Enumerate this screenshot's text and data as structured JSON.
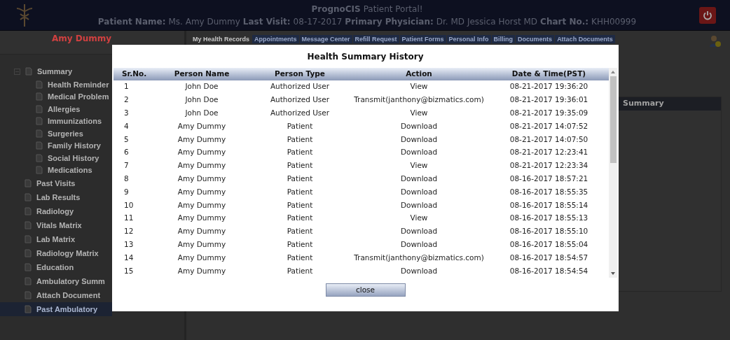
{
  "header": {
    "brand": "PrognoCIS",
    "title": "Patient Portal!",
    "fields": [
      {
        "label": "Patient Name:",
        "value": "Ms. Amy Dummy"
      },
      {
        "label": "Last Visit:",
        "value": "08-17-2017"
      },
      {
        "label": "Primary Physician:",
        "value": "Dr. MD Jessica Horst MD"
      },
      {
        "label": "Chart No.:",
        "value": "KHH00999"
      }
    ]
  },
  "sidebar": {
    "patient_name": "Amy Dummy",
    "tree": [
      {
        "label": "Summary",
        "expanded": true,
        "selected": false,
        "children": [
          {
            "label": "Health Reminder",
            "selected": false
          },
          {
            "label": "Medical Problem",
            "selected": false
          },
          {
            "label": "Allergies",
            "selected": false
          },
          {
            "label": "Immunizations",
            "selected": false
          },
          {
            "label": "Surgeries",
            "selected": false
          },
          {
            "label": "Family History",
            "selected": false
          },
          {
            "label": "Social History",
            "selected": false
          },
          {
            "label": "Medications",
            "selected": false
          }
        ]
      },
      {
        "label": "Past Visits",
        "selected": false
      },
      {
        "label": "Lab Results",
        "selected": false
      },
      {
        "label": "Radiology",
        "selected": false
      },
      {
        "label": "Vitals Matrix",
        "selected": false
      },
      {
        "label": "Lab Matrix",
        "selected": false
      },
      {
        "label": "Radiology Matrix",
        "selected": false
      },
      {
        "label": "Education",
        "selected": false
      },
      {
        "label": "Ambulatory Summ",
        "selected": false
      },
      {
        "label": "Attach Document",
        "selected": false
      },
      {
        "label": "Past Ambulatory",
        "selected": true
      }
    ]
  },
  "tabs": [
    {
      "label": "My Health Records",
      "selected": true
    },
    {
      "label": "Appointments",
      "selected": false
    },
    {
      "label": "Message Center",
      "selected": false
    },
    {
      "label": "Refill Request",
      "selected": false
    },
    {
      "label": "Patient Forms",
      "selected": false
    },
    {
      "label": "Personal Info",
      "selected": false
    },
    {
      "label": "Billing",
      "selected": false
    },
    {
      "label": "Documents",
      "selected": false
    },
    {
      "label": "Attach Documents",
      "selected": false
    }
  ],
  "panel": {
    "heading": "Summary"
  },
  "dialog": {
    "title": "Health Summary History",
    "columns": [
      "Sr.No.",
      "Person Name",
      "Person Type",
      "Action",
      "Date & Time(PST)"
    ],
    "rows": [
      [
        "1",
        "John Doe",
        "Authorized User",
        "View",
        "08-21-2017 19:36:20"
      ],
      [
        "2",
        "John Doe",
        "Authorized User",
        "Transmit(janthony@bizmatics.com)",
        "08-21-2017 19:36:01"
      ],
      [
        "3",
        "John Doe",
        "Authorized User",
        "View",
        "08-21-2017 19:35:09"
      ],
      [
        "4",
        "Amy Dummy",
        "Patient",
        "Download",
        "08-21-2017 14:07:52"
      ],
      [
        "5",
        "Amy Dummy",
        "Patient",
        "Download",
        "08-21-2017 14:07:50"
      ],
      [
        "6",
        "Amy Dummy",
        "Patient",
        "Download",
        "08-21-2017 12:23:41"
      ],
      [
        "7",
        "Amy Dummy",
        "Patient",
        "View",
        "08-21-2017 12:23:34"
      ],
      [
        "8",
        "Amy Dummy",
        "Patient",
        "Download",
        "08-16-2017 18:57:21"
      ],
      [
        "9",
        "Amy Dummy",
        "Patient",
        "Download",
        "08-16-2017 18:55:35"
      ],
      [
        "10",
        "Amy Dummy",
        "Patient",
        "Download",
        "08-16-2017 18:55:14"
      ],
      [
        "11",
        "Amy Dummy",
        "Patient",
        "View",
        "08-16-2017 18:55:13"
      ],
      [
        "12",
        "Amy Dummy",
        "Patient",
        "Download",
        "08-16-2017 18:55:10"
      ],
      [
        "13",
        "Amy Dummy",
        "Patient",
        "Download",
        "08-16-2017 18:55:04"
      ],
      [
        "14",
        "Amy Dummy",
        "Patient",
        "Transmit(janthony@bizmatics.com)",
        "08-16-2017 18:54:57"
      ],
      [
        "15",
        "Amy Dummy",
        "Patient",
        "Download",
        "08-16-2017 18:54:54"
      ]
    ],
    "close_button": "close"
  }
}
